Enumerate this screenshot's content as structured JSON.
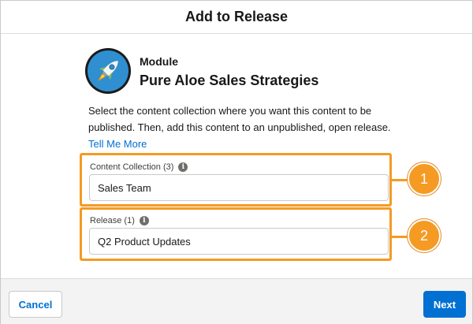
{
  "dialog": {
    "title": "Add to Release"
  },
  "module": {
    "kicker": "Module",
    "name": "Pure Aloe Sales Strategies",
    "icon": "rocket-icon"
  },
  "description": "Select the content collection where you want this content to be published. Then, add this content to an unpublished, open release.",
  "help_link": "Tell Me More",
  "fields": [
    {
      "label": "Content Collection (3)",
      "value": "Sales Team",
      "callout": "1"
    },
    {
      "label": "Release (1)",
      "value": "Q2 Product Updates",
      "callout": "2"
    }
  ],
  "footer": {
    "cancel_label": "Cancel",
    "next_label": "Next"
  },
  "colors": {
    "accent": "#0070d2",
    "callout": "#f59a23"
  }
}
